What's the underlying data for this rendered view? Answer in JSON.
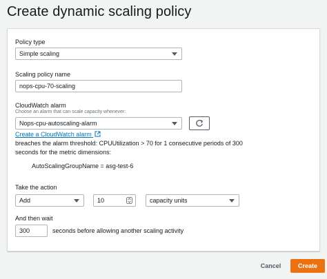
{
  "page": {
    "title": "Create dynamic scaling policy"
  },
  "policy_type": {
    "label": "Policy type",
    "value": "Simple scaling"
  },
  "policy_name": {
    "label": "Scaling policy name",
    "value": "nops-cpu-70-scaling"
  },
  "alarm": {
    "label": "CloudWatch alarm",
    "description": "Choose an alarm that can scale capacity whenever:",
    "value": "Nops-cpu-autoscaling-alarm",
    "create_link": "Create a CloudWatch alarm",
    "breach_line1": "breaches the alarm threshold: CPUUtilization > 70 for 1 consecutive periods of 300",
    "breach_line2": "seconds for the metric dimensions:",
    "dimension": "AutoScalingGroupName = asg-test-6"
  },
  "action": {
    "label": "Take the action",
    "operation": "Add",
    "amount": "10",
    "unit": "capacity units"
  },
  "wait": {
    "label": "And then wait",
    "value": "300",
    "suffix": "seconds before allowing another scaling activity"
  },
  "footer": {
    "cancel": "Cancel",
    "create": "Create"
  },
  "colors": {
    "primary": "#ec7211",
    "link": "#0073bb",
    "border": "#aab7b8"
  }
}
